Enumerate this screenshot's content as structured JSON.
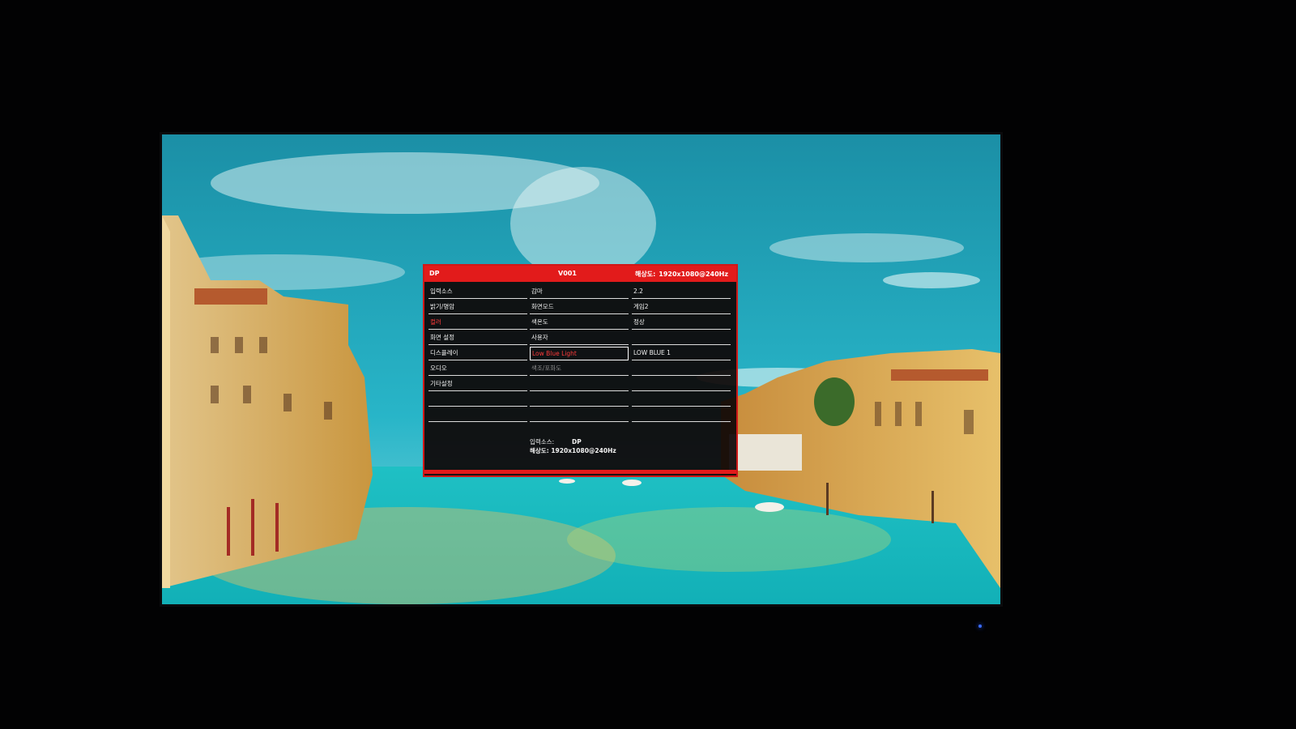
{
  "osd": {
    "header": {
      "input": "DP",
      "model": "V001",
      "resolution_label": "해상도:",
      "resolution_value": "1920x1080@240Hz"
    },
    "menu": [
      {
        "label": "입력소스",
        "state": "normal"
      },
      {
        "label": "밝기/명암",
        "state": "normal"
      },
      {
        "label": "컬러",
        "state": "active"
      },
      {
        "label": "화면 설정",
        "state": "normal"
      },
      {
        "label": "디스플레이",
        "state": "normal"
      },
      {
        "label": "오디오",
        "state": "normal"
      },
      {
        "label": "기타설정",
        "state": "normal"
      }
    ],
    "submenu": [
      {
        "label": "감마",
        "state": "normal"
      },
      {
        "label": "화면모드",
        "state": "normal"
      },
      {
        "label": "색온도",
        "state": "normal"
      },
      {
        "label": "사용자",
        "state": "normal"
      },
      {
        "label": "Low Blue Light",
        "state": "selected"
      },
      {
        "label": "색조/포화도",
        "state": "disabled"
      }
    ],
    "values": [
      {
        "label": "2.2"
      },
      {
        "label": "게임2"
      },
      {
        "label": "정상"
      },
      {
        "label": ""
      },
      {
        "label": "LOW BLUE 1"
      }
    ],
    "footer": {
      "input_label": "입력소스:",
      "input_value": "DP",
      "resolution_label": "해상도:",
      "resolution_value": "1920x1080@240Hz"
    }
  },
  "colors": {
    "accent": "#e21b1b",
    "highlight_text": "#ff3a3a",
    "panel_bg": "#0e0606",
    "power_led": "#3a6cff"
  }
}
